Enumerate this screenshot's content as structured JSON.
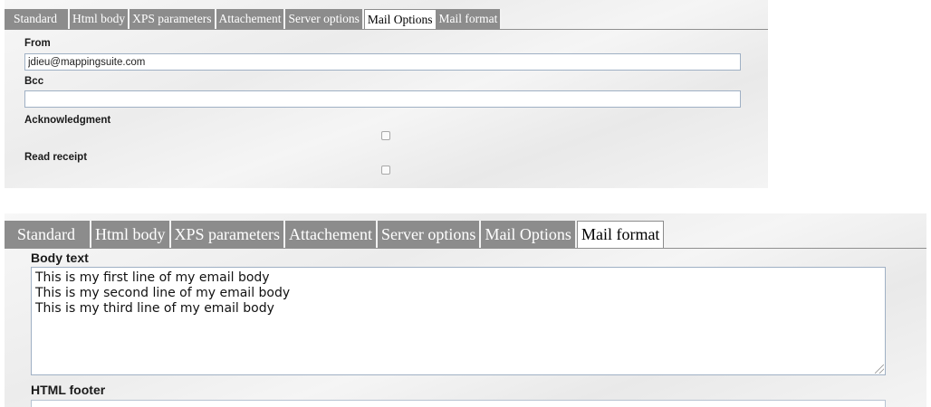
{
  "top_panel": {
    "tabs": [
      "Standard",
      "Html body",
      "XPS parameters",
      "Attachement",
      "Server options",
      "Mail Options",
      "Mail format"
    ],
    "active_tab": "Mail Options",
    "from": {
      "label": "From",
      "value": "jdieu@mappingsuite.com"
    },
    "bcc": {
      "label": "Bcc",
      "value": ""
    },
    "acknowledgment": {
      "label": "Acknowledgment",
      "checked": false
    },
    "read_receipt": {
      "label": "Read receipt",
      "checked": false
    }
  },
  "bottom_panel": {
    "tabs": [
      "Standard",
      "Html body",
      "XPS parameters",
      "Attachement",
      "Server options",
      "Mail Options",
      "Mail format"
    ],
    "active_tab": "Mail format",
    "body_text": {
      "label": "Body text",
      "lines": [
        "This is my first line of my email body",
        "This is my second line of my email body",
        "This is my third line of my email body"
      ]
    },
    "html_footer": {
      "label": "HTML footer"
    }
  }
}
